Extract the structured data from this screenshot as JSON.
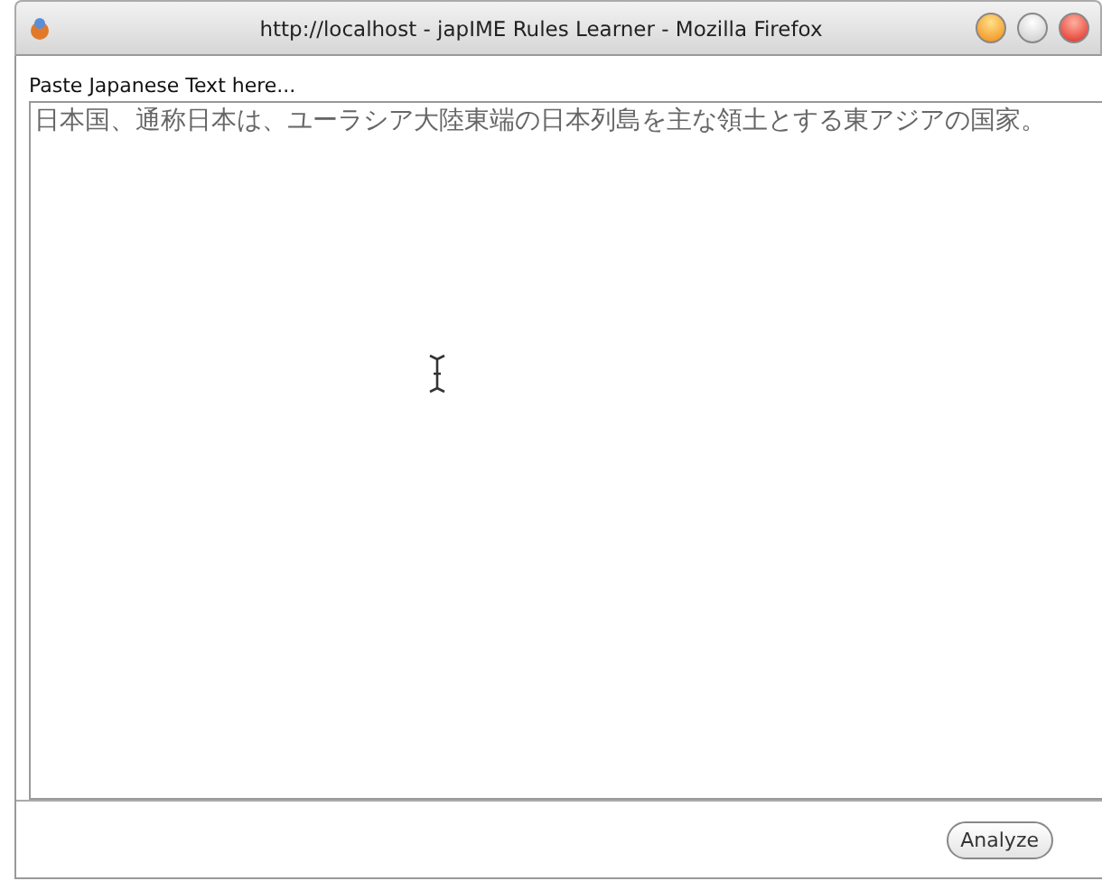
{
  "window": {
    "title": "http://localhost - japIME Rules Learner - Mozilla Firefox"
  },
  "form": {
    "label": "Paste Japanese Text here...",
    "text_area": {
      "value": "日本国、通称日本は、ユーラシア大陸東端の日本列島を主な領土とする東アジアの国家。"
    },
    "button": "Analyze"
  }
}
